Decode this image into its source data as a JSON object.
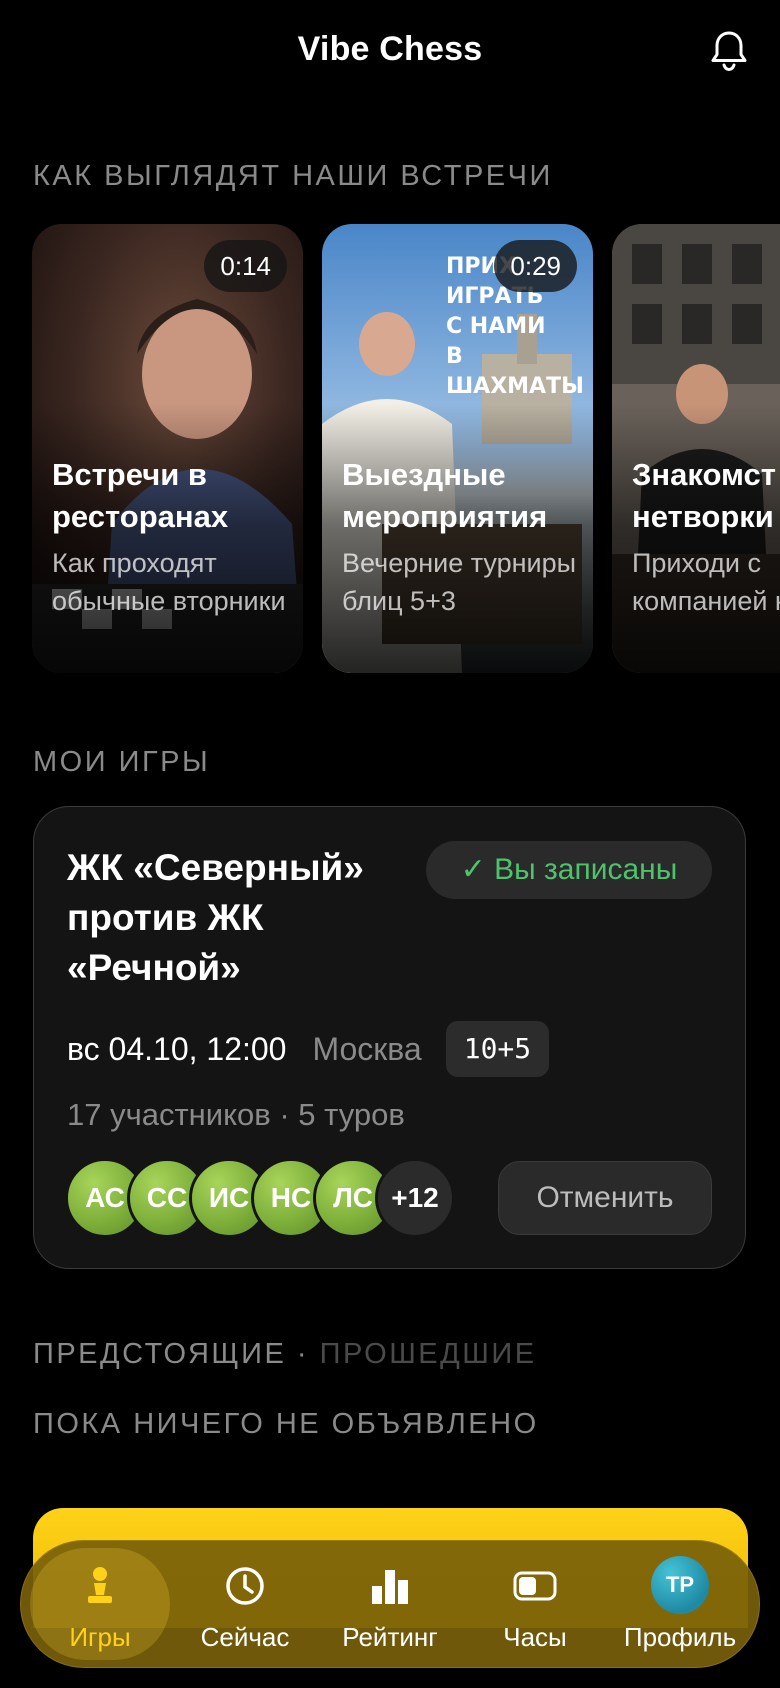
{
  "header": {
    "title": "Vibe Chess",
    "bell_icon": "bell-icon"
  },
  "sections": {
    "meetings_label": "КАК ВЫГЛЯДЯТ НАШИ ВСТРЕЧИ",
    "my_games_label": "МОИ ИГРЫ",
    "filter": {
      "upcoming": "ПРЕДСТОЯЩИЕ",
      "separator": "·",
      "past": "ПРОШЕДШИЕ"
    },
    "empty_note": "ПОКА НИЧЕГО НЕ ОБЪЯВЛЕНО"
  },
  "videos": [
    {
      "duration": "0:14",
      "title": "Встречи в ресторанах",
      "desc": "Как проходят обычные вторники"
    },
    {
      "duration": "0:29",
      "title": "Выездные мероприятия",
      "desc": "Вечерние турниры блиц 5+3",
      "poster": "ПРИХ\nИГРАТЬ\nС НАМИ\nВ ШАХМАТЫ"
    },
    {
      "title": "Знакомст нетворки",
      "desc": "Приходи с компанией найдём"
    }
  ],
  "game": {
    "title": "ЖК «Северный» против ЖК «Речной»",
    "status": "✓ Вы записаны",
    "date": "вс 04.10, 12:00",
    "city": "Москва",
    "time_control": "10+5",
    "participants": "17 участников · 5 туров",
    "avatars": [
      "АС",
      "СС",
      "ИС",
      "НС",
      "ЛС"
    ],
    "more": "+12",
    "cancel_label": "Отменить"
  },
  "nav": [
    {
      "label": "Игры",
      "icon": "pawn-icon",
      "active": true
    },
    {
      "label": "Сейчас",
      "icon": "clock-icon"
    },
    {
      "label": "Рейтинг",
      "icon": "bar-chart-icon"
    },
    {
      "label": "Часы",
      "icon": "chess-clock-icon"
    },
    {
      "label": "Профиль",
      "icon": "avatar",
      "initials": "ТР"
    }
  ],
  "colors": {
    "accent_yellow": "#ffd21a",
    "status_green": "#4dc46b",
    "avatar_green": "#8fc044",
    "profile_teal": "#2aa6bd"
  }
}
